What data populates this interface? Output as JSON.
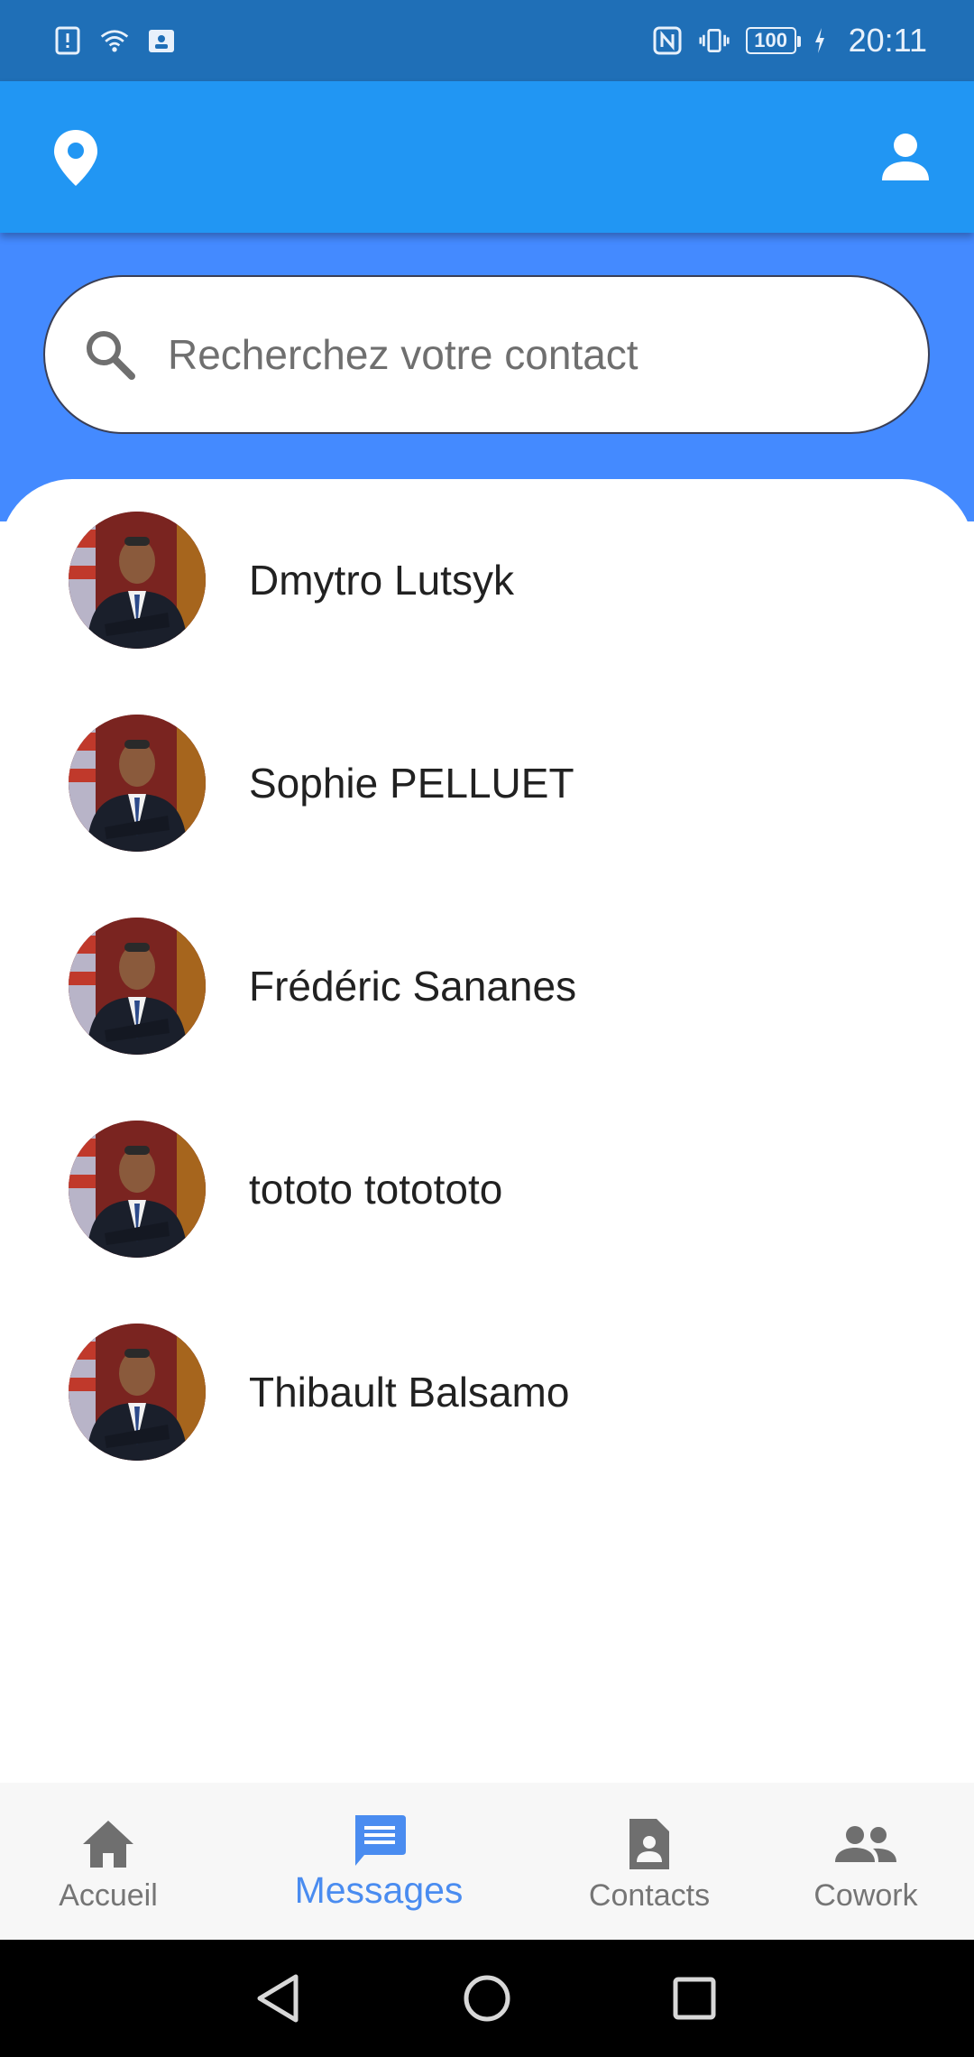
{
  "status_bar": {
    "time": "20:11",
    "battery": "100",
    "icons": [
      "sim-alert-icon",
      "wifi-icon",
      "contact-card-icon",
      "nfc-icon",
      "vibrate-icon",
      "battery-icon",
      "charging-icon"
    ]
  },
  "app_bar": {
    "left_icon": "location-pin-icon",
    "right_icon": "person-icon"
  },
  "search": {
    "placeholder": "Recherchez votre contact"
  },
  "contacts": [
    {
      "name": "Dmytro Lutsyk"
    },
    {
      "name": "Sophie PELLUET"
    },
    {
      "name": "Frédéric Sananes"
    },
    {
      "name": "tototo totototo"
    },
    {
      "name": "Thibault Balsamo"
    }
  ],
  "bottom_nav": {
    "items": [
      {
        "label": "Accueil",
        "icon": "home-icon",
        "active": false
      },
      {
        "label": "Messages",
        "icon": "message-icon",
        "active": true
      },
      {
        "label": "Contacts",
        "icon": "contact-file-icon",
        "active": false
      },
      {
        "label": "Cowork",
        "icon": "people-icon",
        "active": false
      }
    ]
  },
  "colors": {
    "status_bar": "#1f6fb7",
    "app_bar": "#2196f3",
    "band": "#448aff",
    "active_nav": "#4a8cf0"
  }
}
